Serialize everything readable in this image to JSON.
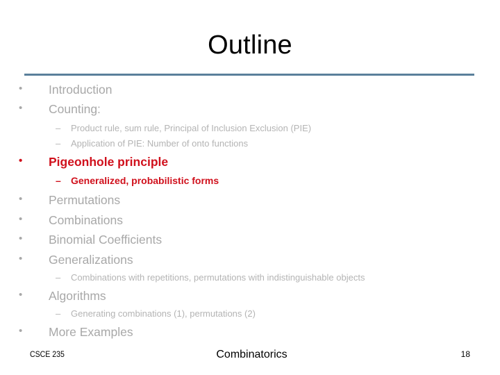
{
  "slide": {
    "title": "Outline",
    "accent_rule_color": "#5a7f9b",
    "highlight_color": "#d0101c",
    "items": [
      {
        "level": 1,
        "bullet": "•",
        "text": "Introduction",
        "highlight": false
      },
      {
        "level": 1,
        "bullet": "•",
        "text": "Counting:",
        "highlight": false
      },
      {
        "level": 2,
        "bullet": "–",
        "text": "Product rule, sum rule, Principal of Inclusion Exclusion (PIE)",
        "highlight": false
      },
      {
        "level": 2,
        "bullet": "–",
        "text": "Application of PIE: Number of onto functions",
        "highlight": false
      },
      {
        "level": 1,
        "bullet": "•",
        "text": "Pigeonhole principle",
        "highlight": true
      },
      {
        "level": 2,
        "bullet": "–",
        "text": "Generalized, probabilistic forms",
        "highlight": true
      },
      {
        "level": 1,
        "bullet": "•",
        "text": "Permutations",
        "highlight": false
      },
      {
        "level": 1,
        "bullet": "•",
        "text": "Combinations",
        "highlight": false
      },
      {
        "level": 1,
        "bullet": "•",
        "text": "Binomial Coefficients",
        "highlight": false
      },
      {
        "level": 1,
        "bullet": "•",
        "text": "Generalizations",
        "highlight": false
      },
      {
        "level": 2,
        "bullet": "–",
        "text": "Combinations with repetitions, permutations with indistinguishable objects",
        "highlight": false
      },
      {
        "level": 1,
        "bullet": "•",
        "text": "Algorithms",
        "highlight": false
      },
      {
        "level": 2,
        "bullet": "–",
        "text": "Generating combinations (1), permutations (2)",
        "highlight": false
      },
      {
        "level": 1,
        "bullet": "•",
        "text": "More Examples",
        "highlight": false
      }
    ]
  },
  "footer": {
    "course": "CSCE 235",
    "topic": "Combinatorics",
    "page_number": "18"
  }
}
